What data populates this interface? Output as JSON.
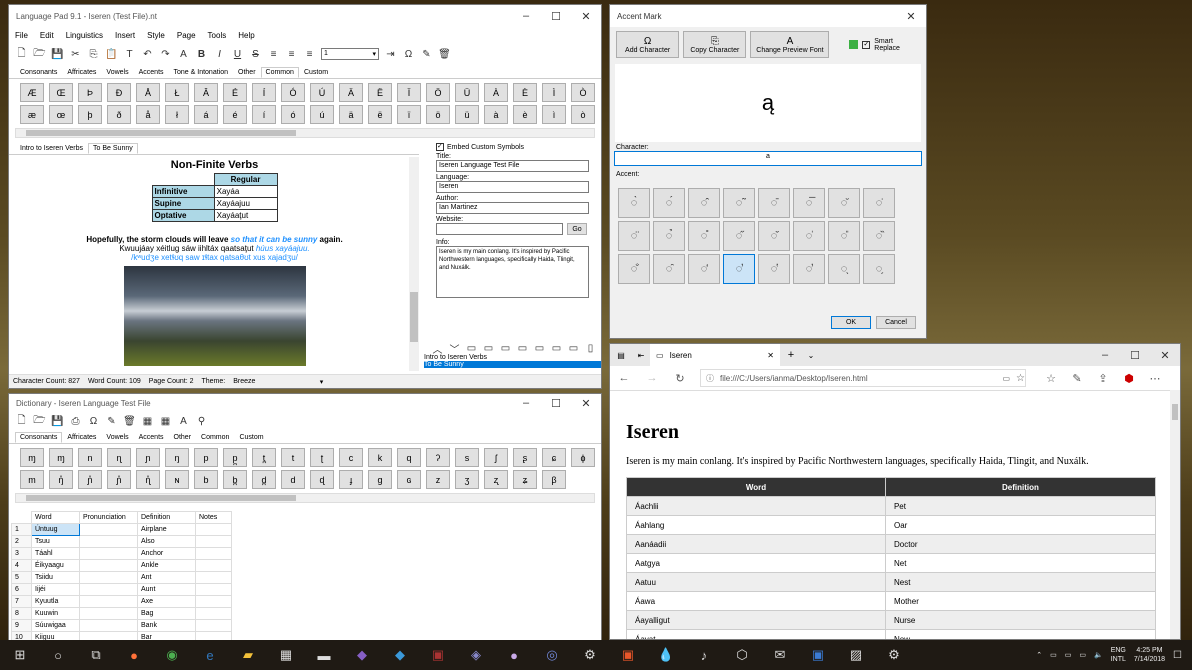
{
  "lp": {
    "title": "Language Pad 9.1 - Iseren (Test File).nt",
    "menu": [
      "File",
      "Edit",
      "Linguistics",
      "Insert",
      "Style",
      "Page",
      "Tools",
      "Help"
    ],
    "font_size": "1",
    "tabs": [
      "Consonants",
      "Affricates",
      "Vowels",
      "Accents",
      "Tone & Intonation",
      "Other",
      "Common",
      "Custom"
    ],
    "active_tab": "Common",
    "row1": [
      "Æ",
      "Œ",
      "Þ",
      "Ð",
      "Å",
      "Ł",
      "Â",
      "É",
      "Í",
      "Ó",
      "Ú",
      "Ä",
      "Ë",
      "Ï",
      "Ö",
      "Ü",
      "À",
      "È",
      "Ì",
      "Ò"
    ],
    "row2": [
      "æ",
      "œ",
      "þ",
      "ð",
      "å",
      "ł",
      "á",
      "é",
      "í",
      "ó",
      "ú",
      "ä",
      "ë",
      "ï",
      "ö",
      "ü",
      "à",
      "è",
      "ì",
      "ò"
    ],
    "doc_tabs": [
      "Intro to Iseren Verbs",
      "To Be Sunny"
    ],
    "doc": {
      "heading": "Non-Finite Verbs",
      "col": "Regular",
      "rows": [
        [
          "Infinitive",
          "Xayáa"
        ],
        [
          "Supine",
          "Xayáajuu"
        ],
        [
          "Optative",
          "Xayáaţut"
        ]
      ],
      "sent_bold": "Hopefully, the storm clouds will leave ",
      "sent_blue": "so that it can be sunny",
      "sent_end": " again.",
      "line2a": "Kwuujáay xéitlug sáw iihltáx qaatsaţut ",
      "line2b": "húus xayáajuu.",
      "ipa": "/kʷudʒe xetɬʊq saw ɪɬtax qatsaθʊt xus xajadʒu/"
    },
    "embed": "Embed Custom Symbols",
    "title_label": "Title:",
    "title_val": "Iseren Language Test File",
    "lang_label": "Language:",
    "lang_val": "Iseren",
    "author_label": "Author:",
    "author_val": "Ian Martinez",
    "web_label": "Website:",
    "go": "Go",
    "info_label": "Info:",
    "info_val": "Iseren is my main conlang. It's inspired by Pacific Northwestern languages, specifically Haida, Tlingit, and Nuxálk.",
    "pages": [
      "Intro to Iseren Verbs",
      "To Be Sunny"
    ],
    "status": {
      "chars": "Character Count: 827",
      "words": "Word Count: 109",
      "pages": "Page Count: 2",
      "theme_label": "Theme:",
      "theme": "Breeze"
    }
  },
  "dict": {
    "title": "Dictionary - Iseren Language Test File",
    "tabs": [
      "Consonants",
      "Affricates",
      "Vowels",
      "Accents",
      "Other",
      "Common",
      "Custom"
    ],
    "row1": [
      "ɱ",
      "ɱ",
      "n",
      "ɳ",
      "ɲ",
      "ŋ",
      "p",
      "p̪",
      "t̪",
      "t",
      "ʈ",
      "c",
      "k",
      "q",
      "ʔ",
      "s",
      "ʃ",
      "ʂ",
      "ɕ",
      "ɸ"
    ],
    "row2": [
      "m",
      "ŋ̊",
      "ɲ̊",
      "ɲ̊",
      "ɳ̊",
      "ɴ",
      "b",
      "b̪",
      "d̪",
      "d",
      "ɖ",
      "ɟ",
      "g",
      "ɢ",
      "z",
      "ʒ",
      "ʐ",
      "ʑ",
      "β"
    ],
    "cols": [
      "Word",
      "Pronunciation",
      "Definition",
      "Notes"
    ],
    "rows": [
      [
        "1",
        "Úntuug",
        "Airplane"
      ],
      [
        "2",
        "Tsuu",
        "Also"
      ],
      [
        "3",
        "Táahl",
        "Anchor"
      ],
      [
        "4",
        "Éikyaagu",
        "Ankle"
      ],
      [
        "5",
        "Tsiidu",
        "Ant"
      ],
      [
        "6",
        "Iijéi",
        "Aunt"
      ],
      [
        "7",
        "Kyuutla",
        "Axe"
      ],
      [
        "8",
        "Kuuwin",
        "Bag"
      ],
      [
        "9",
        "Súuwigaa",
        "Bank"
      ],
      [
        "10",
        "Kiiguu",
        "Bar"
      ]
    ]
  },
  "acc": {
    "title": "Accent Mark",
    "add": "Add Character",
    "copy": "Copy Character",
    "font": "Change Preview Font",
    "smart": "Smart Replace",
    "preview": "ą",
    "char_label": "Character:",
    "char_val": "a",
    "acc_label": "Accent:",
    "ok": "OK",
    "cancel": "Cancel",
    "marks": [
      "◌̀",
      "◌́",
      "◌̂",
      "◌̃",
      "◌̄",
      "◌̅",
      "◌̆",
      "◌̇",
      "◌̈",
      "◌̉",
      "◌̊",
      "◌̋",
      "◌̌",
      "◌̍",
      "◌̎",
      "◌̏",
      "◌̐",
      "◌̑",
      "◌̒",
      "◌̓",
      "◌̔",
      "◌̕",
      "◌̖",
      "◌̗"
    ]
  },
  "edge": {
    "tab": "Iseren",
    "url": "file:///C:/Users/ianma/Desktop/Iseren.html",
    "heading": "Iseren",
    "para": "Iseren is my main conlang. It's inspired by Pacific Northwestern languages, specifically Haida, Tlingit, and Nuxálk.",
    "cols": [
      "Word",
      "Definition"
    ],
    "rows": [
      [
        "Áachlii",
        "Pet"
      ],
      [
        "Áahlang",
        "Oar"
      ],
      [
        "Aanáadii",
        "Doctor"
      ],
      [
        "Aatgya",
        "Net"
      ],
      [
        "Aatuu",
        "Nest"
      ],
      [
        "Áawa",
        "Mother"
      ],
      [
        "Áayalligut",
        "Nurse"
      ],
      [
        "Áayat",
        "Now"
      ]
    ]
  },
  "taskbar": {
    "lang1": "ENG",
    "lang2": "INTL",
    "time": "4:25 PM",
    "date": "7/14/2018"
  }
}
